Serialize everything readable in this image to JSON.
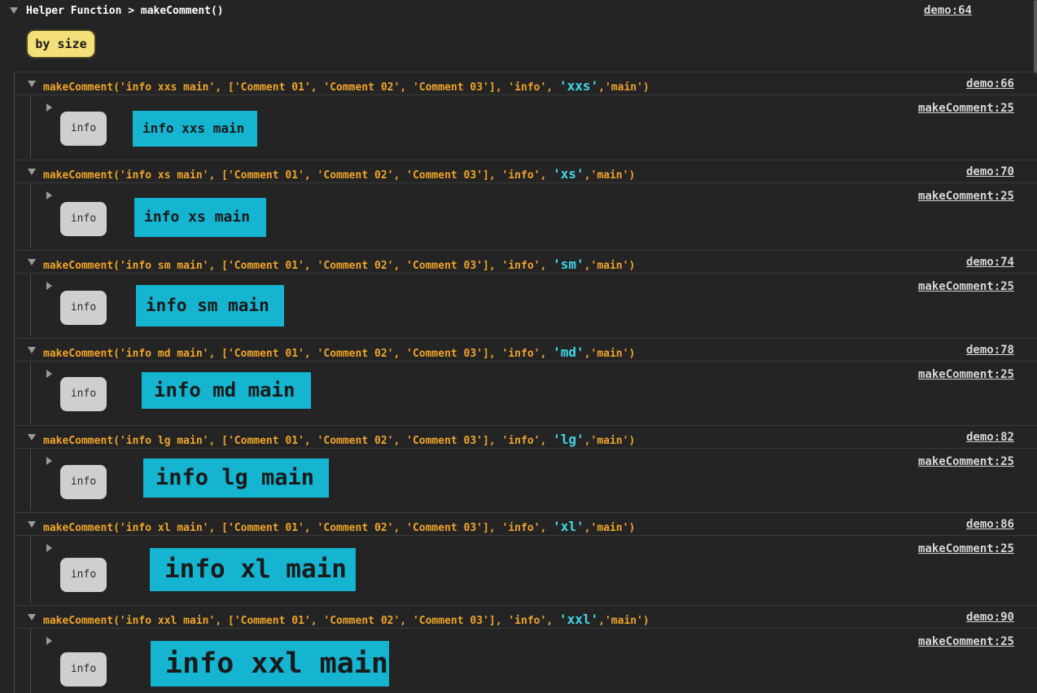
{
  "group": {
    "title": "Helper Function > makeComment()",
    "source": "demo:64",
    "label": "by size"
  },
  "entries": [
    {
      "call_prefix": "makeComment('info xxs main', ['Comment 01', 'Comment 02', 'Comment 03'], 'info', ",
      "call_size": "'xxs'",
      "call_suffix": ",'main')",
      "call_source": "demo:66",
      "pill": "info",
      "message": "info xxs main",
      "message_source": "makeComment:25"
    },
    {
      "call_prefix": "makeComment('info xs main', ['Comment 01', 'Comment 02', 'Comment 03'], 'info', ",
      "call_size": "'xs'",
      "call_suffix": ",'main')",
      "call_source": "demo:70",
      "pill": "info",
      "message": "info xs main",
      "message_source": "makeComment:25"
    },
    {
      "call_prefix": "makeComment('info sm main', ['Comment 01', 'Comment 02', 'Comment 03'], 'info', ",
      "call_size": "'sm'",
      "call_suffix": ",'main')",
      "call_source": "demo:74",
      "pill": "info",
      "message": "info sm main",
      "message_source": "makeComment:25"
    },
    {
      "call_prefix": "makeComment('info md main', ['Comment 01', 'Comment 02', 'Comment 03'], 'info', ",
      "call_size": "'md'",
      "call_suffix": ",'main')",
      "call_source": "demo:78",
      "pill": "info",
      "message": "info md main",
      "message_source": "makeComment:25"
    },
    {
      "call_prefix": "makeComment('info lg main', ['Comment 01', 'Comment 02', 'Comment 03'], 'info', ",
      "call_size": "'lg'",
      "call_suffix": ",'main')",
      "call_source": "demo:82",
      "pill": "info",
      "message": "info lg main",
      "message_source": "makeComment:25"
    },
    {
      "call_prefix": "makeComment('info xl main', ['Comment 01', 'Comment 02', 'Comment 03'], 'info', ",
      "call_size": "'xl'",
      "call_suffix": ",'main')",
      "call_source": "demo:86",
      "pill": "info",
      "message": "info xl main",
      "message_source": "makeComment:25"
    },
    {
      "call_prefix": "makeComment('info xxl main', ['Comment 01', 'Comment 02', 'Comment 03'], 'info', ",
      "call_size": "'xxl'",
      "call_suffix": ",'main')",
      "call_source": "demo:90",
      "pill": "info",
      "message": "info xxl main",
      "message_source": "makeComment:25"
    }
  ],
  "colors": {
    "background": "#242424",
    "call_text": "#f0a52a",
    "size_highlight": "#3fd8e8",
    "badge": "#f3e07a",
    "message_box": "#15b4d0",
    "pill": "#cfcfcf"
  },
  "icons": {
    "expanded": "triangle-down-icon",
    "collapsed": "triangle-right-icon"
  }
}
